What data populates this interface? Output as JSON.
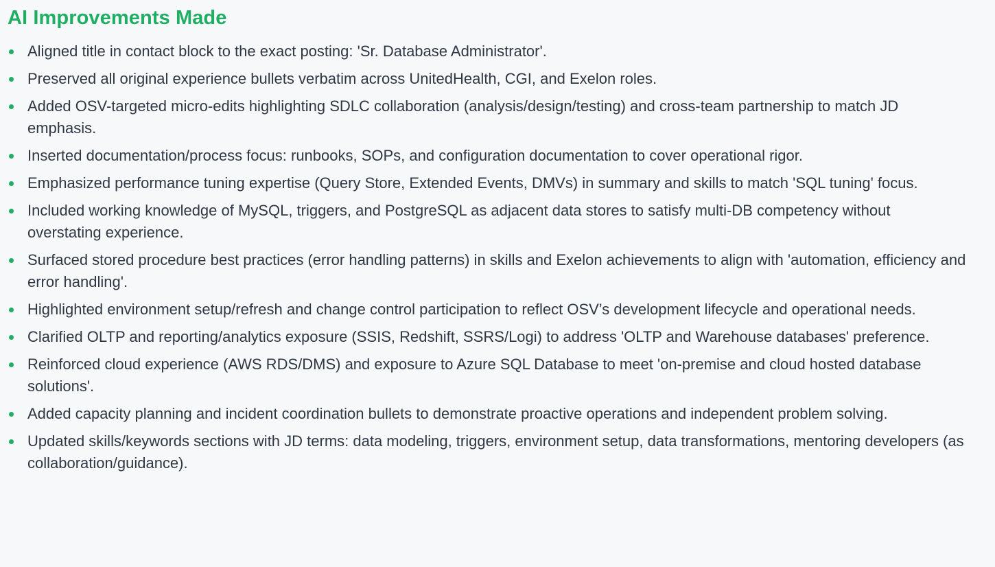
{
  "section": {
    "title": "AI Improvements Made",
    "accent_color": "#1fae63",
    "items": [
      "Aligned title in contact block to the exact posting: 'Sr. Database Administrator'.",
      "Preserved all original experience bullets verbatim across UnitedHealth, CGI, and Exelon roles.",
      "Added OSV-targeted micro-edits highlighting SDLC collaboration (analysis/design/testing) and cross-team partnership to match JD emphasis.",
      "Inserted documentation/process focus: runbooks, SOPs, and configuration documentation to cover operational rigor.",
      "Emphasized performance tuning expertise (Query Store, Extended Events, DMVs) in summary and skills to match 'SQL tuning' focus.",
      "Included working knowledge of MySQL, triggers, and PostgreSQL as adjacent data stores to satisfy multi-DB competency without overstating experience.",
      "Surfaced stored procedure best practices (error handling patterns) in skills and Exelon achievements to align with 'automation, efficiency and error handling'.",
      "Highlighted environment setup/refresh and change control participation to reflect OSV’s development lifecycle and operational needs.",
      "Clarified OLTP and reporting/analytics exposure (SSIS, Redshift, SSRS/Logi) to address 'OLTP and Warehouse databases' preference.",
      "Reinforced cloud experience (AWS RDS/DMS) and exposure to Azure SQL Database to meet 'on-premise and cloud hosted database solutions'.",
      "Added capacity planning and incident coordination bullets to demonstrate proactive operations and independent problem solving.",
      "Updated skills/keywords sections with JD terms: data modeling, triggers, environment setup, data transformations, mentoring developers (as collaboration/guidance)."
    ]
  }
}
